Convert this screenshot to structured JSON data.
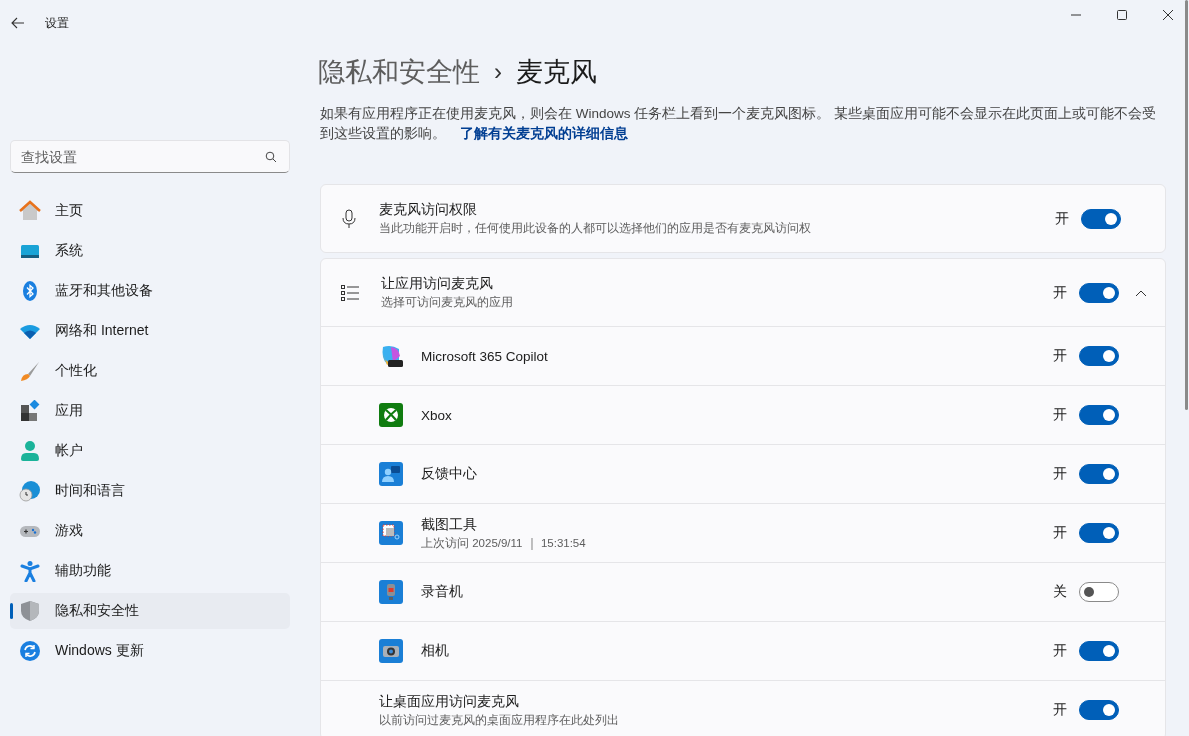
{
  "window": {
    "title": "设置"
  },
  "search": {
    "placeholder": "查找设置"
  },
  "sidebar": {
    "items": [
      {
        "label": "主页",
        "selected": false
      },
      {
        "label": "系统",
        "selected": false
      },
      {
        "label": "蓝牙和其他设备",
        "selected": false
      },
      {
        "label": "网络和 Internet",
        "selected": false
      },
      {
        "label": "个性化",
        "selected": false
      },
      {
        "label": "应用",
        "selected": false
      },
      {
        "label": "帐户",
        "selected": false
      },
      {
        "label": "时间和语言",
        "selected": false
      },
      {
        "label": "游戏",
        "selected": false
      },
      {
        "label": "辅助功能",
        "selected": false
      },
      {
        "label": "隐私和安全性",
        "selected": true
      },
      {
        "label": "Windows 更新",
        "selected": false
      }
    ]
  },
  "breadcrumb": [
    "隐私和安全性",
    "麦克风"
  ],
  "breadcrumb_separator": "›",
  "description": {
    "text": "如果有应用程序正在使用麦克风，则会在 Windows 任务栏上看到一个麦克风图标。 某些桌面应用可能不会显示在此页面上或可能不会受到这些设置的影响。",
    "link": "了解有关麦克风的详细信息"
  },
  "access_card": {
    "title": "麦克风访问权限",
    "subtitle": "当此功能开启时，任何使用此设备的人都可以选择他们的应用是否有麦克风访问权",
    "status": "开",
    "on": true
  },
  "apps_card": {
    "title": "让应用访问麦克风",
    "subtitle": "选择可访问麦克风的应用",
    "status": "开",
    "on": true,
    "expanded": true,
    "apps": [
      {
        "name": "Microsoft 365 Copilot",
        "status": "开",
        "on": true
      },
      {
        "name": "Xbox",
        "status": "开",
        "on": true
      },
      {
        "name": "反馈中心",
        "status": "开",
        "on": true
      },
      {
        "name": "截图工具",
        "detail": "上次访问 2025/9/11 ｜ 15:31:54",
        "status": "开",
        "on": true
      },
      {
        "name": "录音机",
        "status": "关",
        "on": false
      },
      {
        "name": "相机",
        "status": "开",
        "on": true
      }
    ]
  },
  "desktop_card": {
    "title": "让桌面应用访问麦克风",
    "subtitle": "以前访问过麦克风的桌面应用程序在此处列出",
    "status": "开",
    "on": true
  }
}
